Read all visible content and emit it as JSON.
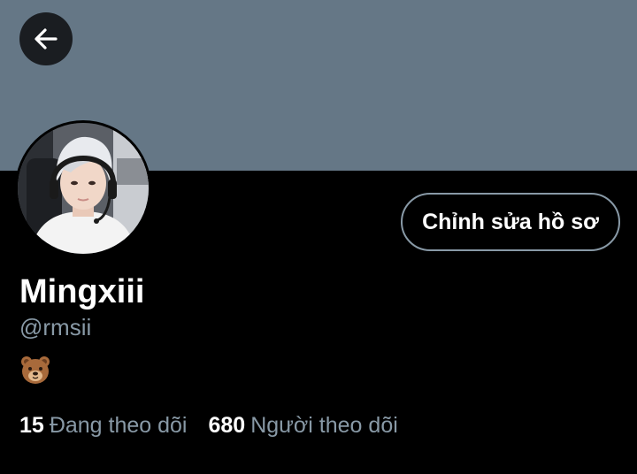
{
  "profile": {
    "display_name": "Mingxiii",
    "handle": "@rmsii",
    "bio_emoji": "bear-face-emoji",
    "edit_button_label": "Chỉnh sửa hồ sơ",
    "back_icon": "arrow-left-icon"
  },
  "stats": {
    "following_count": "15",
    "following_label": "Đang theo dõi",
    "followers_count": "680",
    "followers_label": "Người theo dõi"
  },
  "colors": {
    "banner": "#657786",
    "background": "#000000",
    "secondary_text": "#8899a6",
    "button_border": "#8899a6"
  }
}
